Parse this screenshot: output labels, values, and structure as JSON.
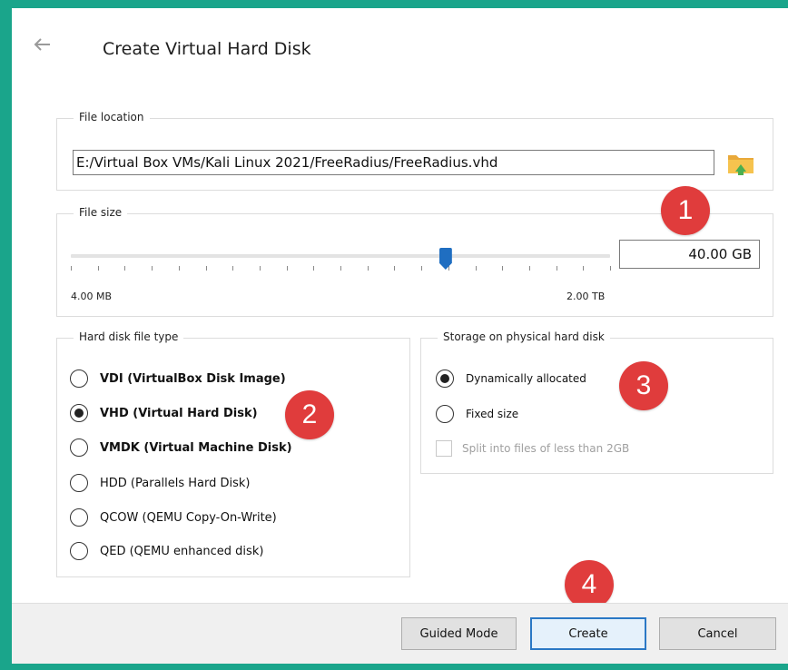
{
  "dialog": {
    "title": "Create Virtual Hard Disk"
  },
  "file_location": {
    "group_label": "File location",
    "path_value": "E:/Virtual Box VMs/Kali Linux 2021/FreeRadius/FreeRadius.vhd"
  },
  "file_size": {
    "group_label": "File size",
    "value": "40.00 GB",
    "min_label": "4.00 MB",
    "max_label": "2.00 TB",
    "slider_fraction": 0.695,
    "tick_count": 21
  },
  "disk_type": {
    "group_label": "Hard disk file type",
    "options": [
      {
        "label": "VDI (VirtualBox Disk Image)",
        "checked": false,
        "bold": true
      },
      {
        "label": "VHD (Virtual Hard Disk)",
        "checked": true,
        "bold": true
      },
      {
        "label": "VMDK (Virtual Machine Disk)",
        "checked": false,
        "bold": true
      },
      {
        "label": "HDD (Parallels Hard Disk)",
        "checked": false,
        "bold": false
      },
      {
        "label": "QCOW (QEMU Copy-On-Write)",
        "checked": false,
        "bold": false
      },
      {
        "label": "QED (QEMU enhanced disk)",
        "checked": false,
        "bold": false
      }
    ]
  },
  "storage": {
    "group_label": "Storage on physical hard disk",
    "options": [
      {
        "label": "Dynamically allocated",
        "checked": true
      },
      {
        "label": "Fixed size",
        "checked": false
      }
    ],
    "split_label": "Split into files of less than 2GB",
    "split_checked": false,
    "split_enabled": false
  },
  "buttons": {
    "guided_mode": "Guided Mode",
    "create": "Create",
    "cancel": "Cancel"
  },
  "markers": [
    "1",
    "2",
    "3",
    "4"
  ],
  "colors": {
    "frame": "#1aa58b",
    "marker": "#e03c3c",
    "slider_thumb": "#1f6ec1",
    "default_button_border": "#2b78c5"
  }
}
